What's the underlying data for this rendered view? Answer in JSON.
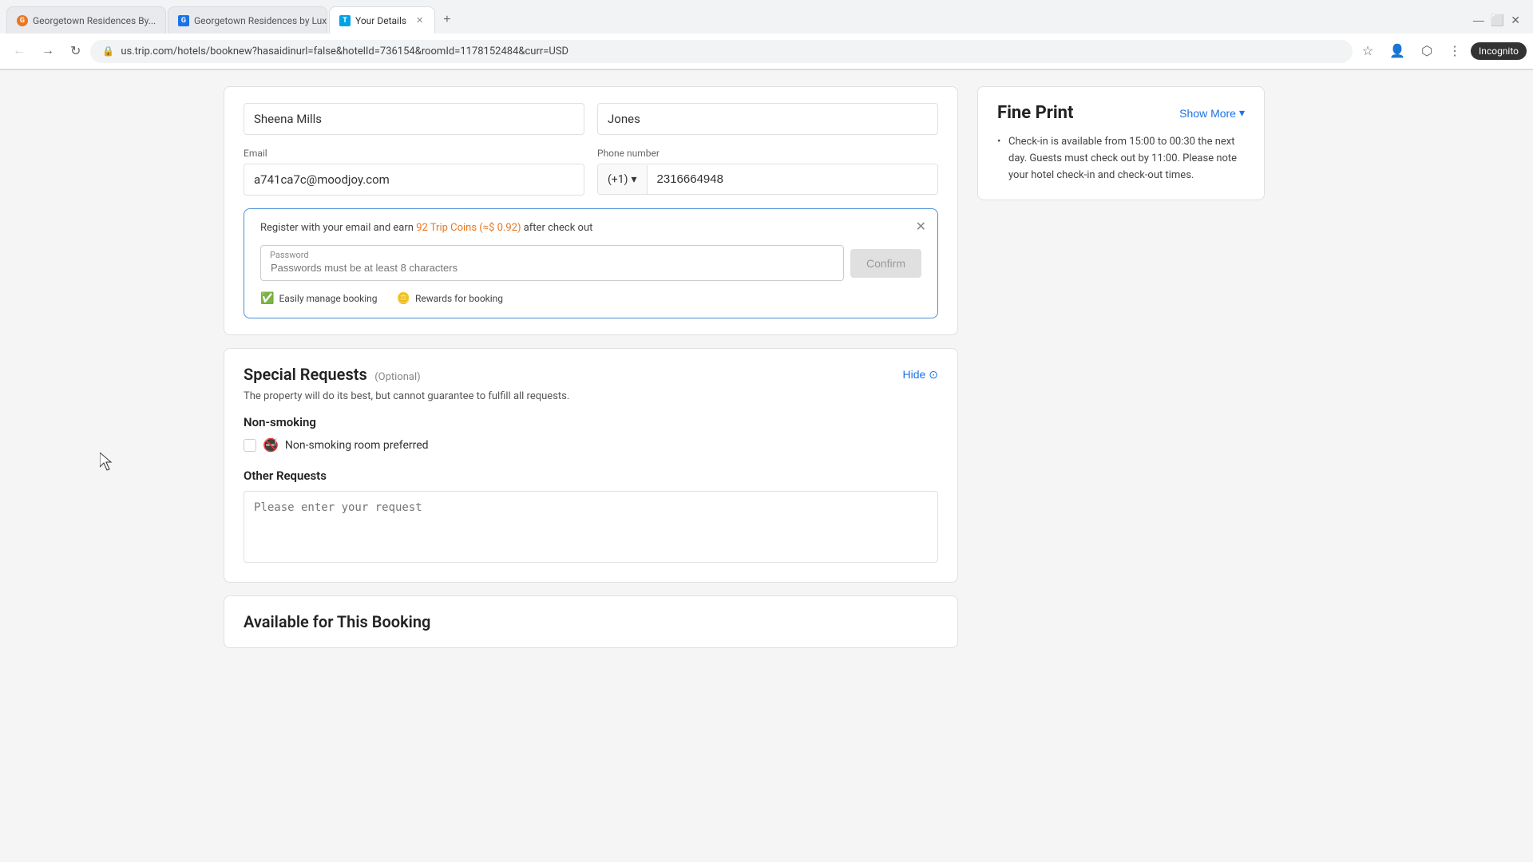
{
  "browser": {
    "tabs": [
      {
        "id": "tab1",
        "favicon_color": "orange",
        "label": "Georgetown Residences By...",
        "active": false,
        "favicon_char": "G"
      },
      {
        "id": "tab2",
        "favicon_color": "blue",
        "label": "Georgetown Residences by Lux...",
        "active": false,
        "favicon_char": "G"
      },
      {
        "id": "tab3",
        "favicon_color": "trip",
        "label": "Your Details",
        "active": true,
        "favicon_char": "T"
      }
    ],
    "url": "us.trip.com/hotels/booknew?hasaidinurl=false&hotelId=736154&roomId=1178152484&curr=USD",
    "incognito_label": "Incognito"
  },
  "form": {
    "first_name_label": "",
    "first_name_value": "Sheena Mills",
    "last_name_label": "",
    "last_name_value": "Jones",
    "email_label": "Email",
    "email_value": "a741ca7c@moodjoy.com",
    "phone_label": "Phone number",
    "phone_prefix": "(+1)",
    "phone_number": "2316664948"
  },
  "register_banner": {
    "text_before": "Register with your email and earn ",
    "coins_text": "92 Trip Coins (≈$ 0.92)",
    "text_after": " after check out",
    "password_label": "Password",
    "password_placeholder": "Passwords must be at least 8 characters",
    "confirm_btn_label": "Confirm",
    "benefit1": "Easily manage booking",
    "benefit2": "Rewards for booking"
  },
  "special_requests": {
    "title": "Special Requests",
    "optional_label": "(Optional)",
    "hide_btn_label": "Hide",
    "description": "The property will do its best, but cannot guarantee to fulfill all requests.",
    "non_smoking_title": "Non-smoking",
    "non_smoking_option": "Non-smoking room preferred",
    "other_requests_title": "Other Requests",
    "other_requests_placeholder": "Please enter your request"
  },
  "available_section": {
    "title": "Available for This Booking"
  },
  "fine_print": {
    "title": "Fine Print",
    "show_more_label": "Show More",
    "item": "Check-in is available from 15:00 to 00:30 the next day. Guests must check out by 11:00. Please note your hotel check-in and check-out times."
  },
  "colors": {
    "accent_blue": "#1a73e8",
    "trip_orange": "#e87722",
    "border": "#e0e0e0",
    "text_primary": "#222",
    "text_secondary": "#666"
  }
}
